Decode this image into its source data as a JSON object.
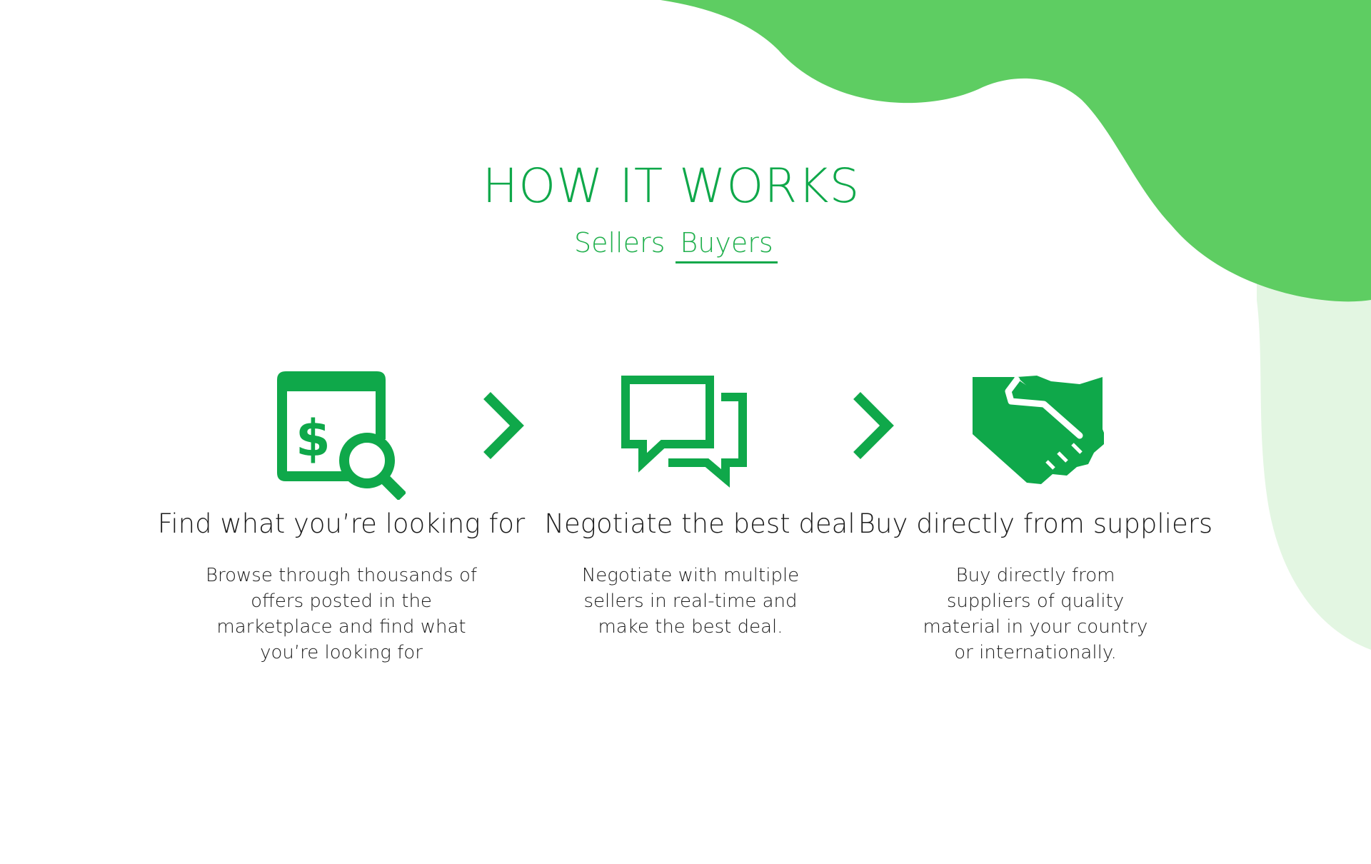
{
  "colors": {
    "accent": "#0fa84a",
    "blob_dark": "#5ecd62",
    "blob_light": "#e3f6e2",
    "text": "#1c1c1c"
  },
  "section": {
    "title": "HOW IT WORKS",
    "tabs": [
      {
        "label": "Sellers",
        "active": false
      },
      {
        "label": "Buyers",
        "active": true
      }
    ]
  },
  "steps": [
    {
      "icon": "dollar-search-icon",
      "title": "Find what you’re looking for",
      "description_lines": [
        "Browse through thousands of",
        "offers posted in the",
        "marketplace and find what",
        "you’re looking for"
      ]
    },
    {
      "icon": "chat-bubbles-icon",
      "title": "Negotiate the best deal",
      "description_lines": [
        "Negotiate with multiple",
        "sellers in real-time and",
        "make the best deal."
      ]
    },
    {
      "icon": "handshake-icon",
      "title": "Buy directly from suppliers",
      "description_lines": [
        "Buy directly from",
        "suppliers of quality",
        "material in your country",
        "or internationally."
      ]
    }
  ],
  "separators": [
    "chevron-right-icon",
    "chevron-right-icon"
  ]
}
